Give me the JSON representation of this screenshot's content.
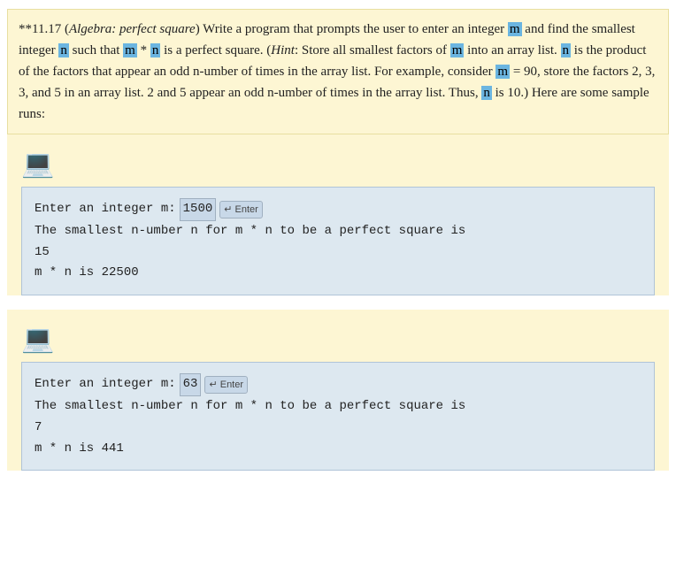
{
  "problem": {
    "number": "**11.17",
    "title": "Algebra: perfect square",
    "description_parts": [
      "Write a program that prompts the user to enter an integer ",
      "m",
      " and find the smallest integer ",
      "n",
      " such that ",
      "m",
      " * ",
      "n",
      " is a perfect square. (",
      "Hint",
      ": Store all smallest factors of ",
      "m",
      " into an array list. ",
      "n",
      " is the product of the factors that appear an odd n-umber of times in the array list. For example, consider ",
      "m",
      " = 90, store the factors 2, 3, 3, and 5 in an array list. 2 and 5 appear an odd n-umber of times in the array list. Thus, ",
      "n",
      " is 10.) Here are some sample runs:"
    ]
  },
  "runs": [
    {
      "prompt_text": "Enter an integer m: ",
      "input_value": "1500",
      "enter_label": "↵ Enter",
      "output_line1": "The smallest n-umber n for m * n to be a perfect square is",
      "output_line2": "15",
      "output_line3": "m * n is 22500"
    },
    {
      "prompt_text": "Enter an integer m: ",
      "input_value": "63",
      "enter_label": "↵ Enter",
      "output_line1": "The smallest n-umber n for m * n to be a perfect square is",
      "output_line2": "7",
      "output_line3": "m * n is 441"
    }
  ],
  "laptop_emoji": "💻"
}
